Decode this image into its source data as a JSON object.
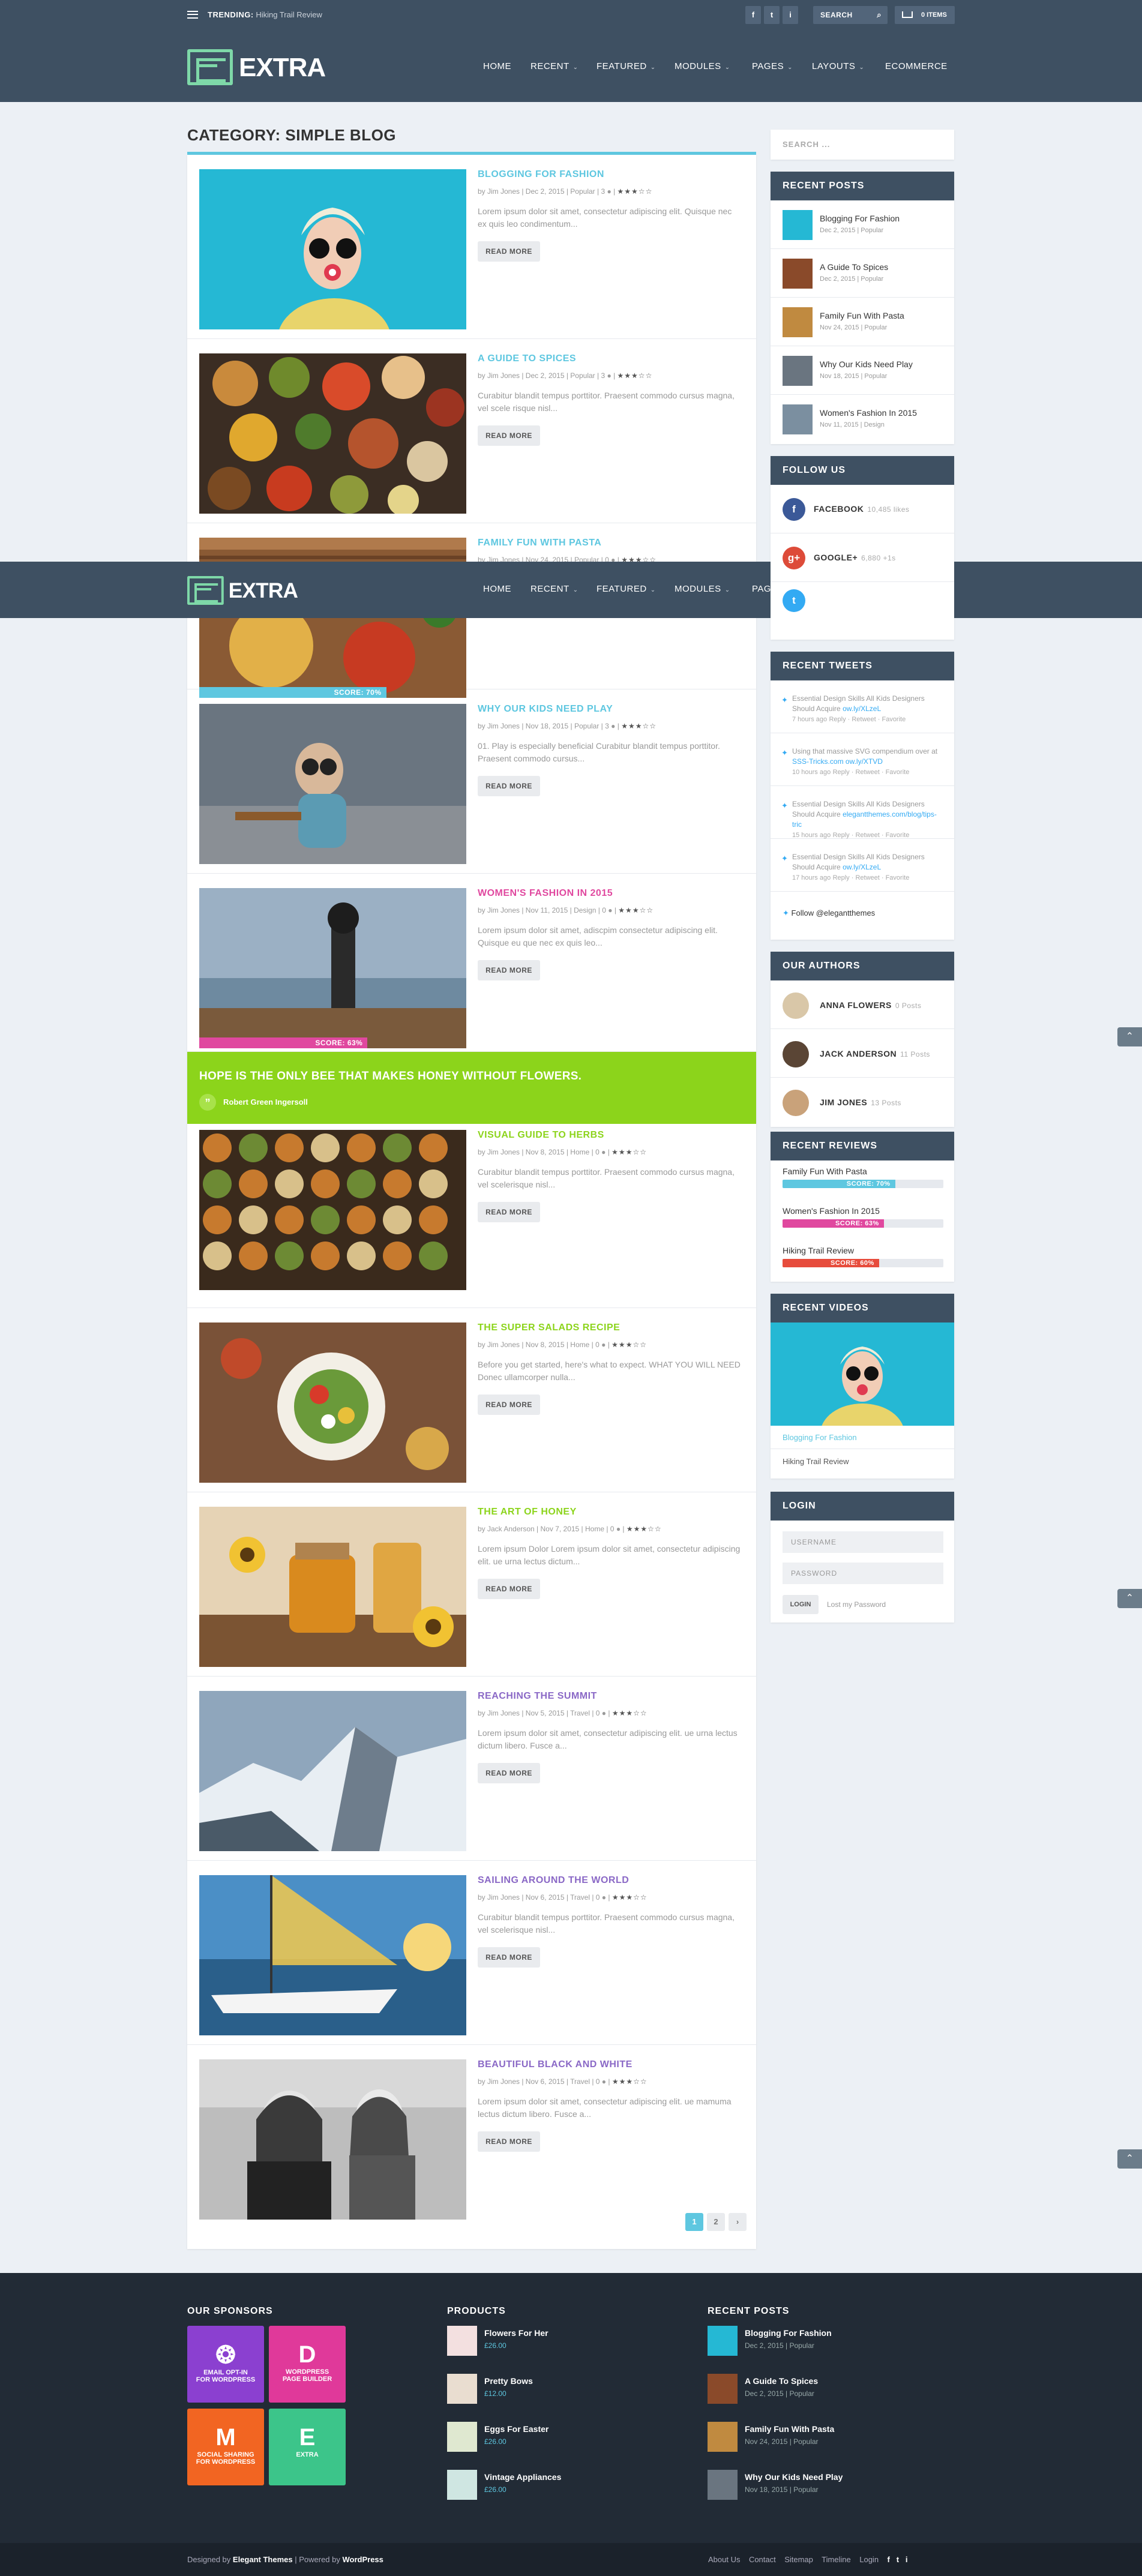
{
  "topbar": {
    "trending_label": "TRENDING:",
    "trending_value": "Hiking Trail Review",
    "social": [
      "f",
      "t",
      "i"
    ],
    "search_label": "SEARCH",
    "cart_label": "0 ITEMS"
  },
  "header": {
    "logo_text": "EXTRA",
    "nav": [
      {
        "label": "HOME"
      },
      {
        "label": "RECENT",
        "caret": "⌄"
      },
      {
        "label": "FEATURED",
        "caret": "⌄"
      },
      {
        "label": "MODULES",
        "caret": "⌄"
      },
      {
        "label": "PAGES",
        "caret": "⌄"
      },
      {
        "label": "LAYOUTS",
        "caret": "⌄"
      },
      {
        "label": "ECOMMERCE"
      }
    ]
  },
  "category_title": "CATEGORY: SIMPLE BLOG",
  "read_more": "READ MORE",
  "posts": [
    {
      "title": "BLOGGING FOR FASHION",
      "color": "#5ec7e0",
      "meta": "by Jim Jones | Dec 2, 2015 | Popular | 3",
      "stars": "★★★☆☆",
      "excerpt": "Lorem ipsum dolor sit amet, consectetur adipiscing elit. Quisque nec ex quis leo condimentum..."
    },
    {
      "title": "A GUIDE TO SPICES",
      "color": "#5ec7e0",
      "meta": "by Jim Jones | Dec 2, 2015 | Popular | 3",
      "stars": "★★★☆☆",
      "excerpt": "Curabitur blandit tempus porttitor. Praesent commodo cursus magna, vel scele risque nisl..."
    },
    {
      "title": "FAMILY FUN WITH PASTA",
      "color": "#5ec7e0",
      "meta": "by Jim Jones | Nov 24, 2015 | Popular | 0",
      "stars": "★★★☆☆",
      "excerpt": "",
      "score": "SCORE: 70%",
      "score_pct": 70
    },
    {
      "title": "WHY OUR KIDS NEED PLAY",
      "color": "#5ec7e0",
      "meta": "by Jim Jones | Nov 18, 2015 | Popular | 3",
      "stars": "★★★☆☆",
      "excerpt": "01. Play is especially beneficial Curabitur blandit tempus porttitor. Praesent commodo cursus..."
    },
    {
      "title": "WOMEN'S FASHION IN 2015",
      "color": "#e0489f",
      "meta": "by Jim Jones | Nov 11, 2015 | Design | 0",
      "stars": "★★★☆☆",
      "excerpt": "Lorem ipsum dolor sit amet, adiscpim consectetur adipiscing elit. Quisque eu que nec ex quis leo...",
      "score": "SCORE: 63%",
      "score_pct": 63
    },
    {
      "title": "VISUAL GUIDE TO HERBS",
      "color": "#8cd41b",
      "meta": "by Jim Jones | Nov 8, 2015 | Home | 0",
      "stars": "★★★☆☆",
      "excerpt": "Curabitur blandit tempus porttitor. Praesent commodo cursus magna, vel scelerisque nisl..."
    },
    {
      "title": "THE SUPER SALADS RECIPE",
      "color": "#8cd41b",
      "meta": "by Jim Jones | Nov 8, 2015 | Home | 0",
      "stars": "★★★☆☆",
      "excerpt": "Before you get started, here's what to expect. WHAT YOU WILL NEED Donec ullamcorper nulla..."
    },
    {
      "title": "THE ART OF HONEY",
      "color": "#8cd41b",
      "meta": "by Jack Anderson | Nov 7, 2015 | Home | 0",
      "stars": "★★★☆☆",
      "excerpt": "Lorem ipsum Dolor Lorem ipsum dolor sit amet, consectetur adipiscing elit. ue urna lectus dictum..."
    },
    {
      "title": "REACHING THE SUMMIT",
      "color": "#8a68c6",
      "meta": "by Jim Jones | Nov 5, 2015 | Travel | 0",
      "stars": "★★★☆☆",
      "excerpt": "Lorem ipsum dolor sit amet, consectetur adipiscing elit. ue urna lectus dictum libero. Fusce a..."
    },
    {
      "title": "SAILING AROUND THE WORLD",
      "color": "#8a68c6",
      "meta": "by Jim Jones | Nov 6, 2015 | Travel | 0",
      "stars": "★★★☆☆",
      "excerpt": "Curabitur blandit tempus porttitor. Praesent commodo cursus magna, vel scelerisque nisl..."
    },
    {
      "title": "BEAUTIFUL BLACK AND WHITE",
      "color": "#8a68c6",
      "meta": "by Jim Jones | Nov 6, 2015 | Travel | 0",
      "stars": "★★★☆☆",
      "excerpt": "Lorem ipsum dolor sit amet, consectetur adipiscing elit. ue mamuma lectus dictum libero. Fusce a..."
    }
  ],
  "quote": {
    "text": "HOPE IS THE ONLY BEE THAT MAKES HONEY WITHOUT FLOWERS.",
    "mark": "”",
    "author": "Robert Green Ingersoll"
  },
  "pagination": [
    "1",
    "2",
    "›"
  ],
  "sidebar": {
    "search_placeholder": "SEARCH ...",
    "recent_posts_title": "RECENT POSTS",
    "recent_posts": [
      {
        "title": "Blogging For Fashion",
        "date": "Dec 2, 2015 | Popular"
      },
      {
        "title": "A Guide To Spices",
        "date": "Dec 2, 2015 | Popular"
      },
      {
        "title": "Family Fun With Pasta",
        "date": "Nov 24, 2015 | Popular"
      },
      {
        "title": "Why Our Kids Need Play",
        "date": "Nov 18, 2015 | Popular"
      },
      {
        "title": "Women's Fashion In 2015",
        "date": "Nov 11, 2015 | Design"
      }
    ],
    "follow_title": "FOLLOW US",
    "follow": [
      {
        "icon": "f",
        "label": "FACEBOOK",
        "count": "10,485 likes",
        "color": "#3b5998"
      },
      {
        "icon": "g+",
        "label": "GOOGLE+",
        "count": "6,880 +1s",
        "color": "#dd4b39"
      }
    ],
    "tweets_title": "RECENT TWEETS",
    "tweets": [
      {
        "text": "Essential Design Skills All Kids Designers Should Acquire",
        "link": "ow.ly/XLzeL",
        "meta": "7 hours ago",
        "actions": "Reply · Retweet · Favorite"
      },
      {
        "text": "Using that massive SVG compendium over at",
        "link": "SSS-Tricks.com ow.ly/XTVD",
        "meta": "10 hours ago",
        "actions": "Reply · Retweet · Favorite"
      },
      {
        "text": "Essential Design Skills All Kids Designers Should Acquire",
        "link": "elegantthemes.com/blog/tips-tric",
        "meta": "15 hours ago",
        "actions": "Reply · Retweet · Favorite"
      },
      {
        "text": "Essential Design Skills All Kids Designers Should Acquire",
        "link": "ow.ly/XLzeL",
        "meta": "17 hours ago",
        "actions": "Reply · Retweet · Favorite"
      }
    ],
    "follow_twitter": "Follow @elegantthemes",
    "authors_title": "OUR AUTHORS",
    "authors": [
      {
        "name": "ANNA FLOWERS",
        "posts": "0 Posts"
      },
      {
        "name": "JACK ANDERSON",
        "posts": "11 Posts"
      },
      {
        "name": "JIM JONES",
        "posts": "13 Posts"
      }
    ],
    "reviews_title": "RECENT REVIEWS",
    "reviews": [
      {
        "title": "Family Fun With Pasta",
        "score": "SCORE: 70%",
        "pct": 70,
        "color": "#5ec7e0"
      },
      {
        "title": "Women's Fashion In 2015",
        "score": "SCORE: 63%",
        "pct": 63,
        "color": "#e0489f"
      },
      {
        "title": "Hiking Trail Review",
        "score": "SCORE: 60%",
        "pct": 60,
        "color": "#e74c3c"
      }
    ],
    "videos_title": "RECENT VIDEOS",
    "videos": [
      "Blogging For Fashion",
      "Hiking Trail Review"
    ],
    "login_title": "LOGIN",
    "login_username": "USERNAME",
    "login_password": "PASSWORD",
    "login_button": "LOGIN",
    "login_lost": "Lost my Password"
  },
  "footer": {
    "sponsors_title": "OUR SPONSORS",
    "sponsors": [
      {
        "big": "❂",
        "label": "EMAIL OPT-IN",
        "sub": "FOR WORDPRESS",
        "color": "#8b40d0"
      },
      {
        "big": "D",
        "label": "WORDPRESS",
        "sub": "PAGE BUILDER",
        "color": "#e0399a"
      },
      {
        "big": "M",
        "label": "SOCIAL SHARING",
        "sub": "FOR WORDPRESS",
        "color": "#f26522"
      },
      {
        "big": "E",
        "label": "EXTRA",
        "sub": "",
        "color": "#3cc58a"
      }
    ],
    "products_title": "PRODUCTS",
    "products": [
      {
        "title": "Flowers For Her",
        "price": "£26.00"
      },
      {
        "title": "Pretty Bows",
        "price": "£12.00"
      },
      {
        "title": "Eggs For Easter",
        "price": "£26.00"
      },
      {
        "title": "Vintage Appliances",
        "price": "£26.00"
      }
    ],
    "recent_title": "RECENT POSTS",
    "recent": [
      {
        "title": "Blogging For Fashion",
        "date": "Dec 2, 2015 | Popular"
      },
      {
        "title": "A Guide To Spices",
        "date": "Dec 2, 2015 | Popular"
      },
      {
        "title": "Family Fun With Pasta",
        "date": "Nov 24, 2015 | Popular"
      },
      {
        "title": "Why Our Kids Need Play",
        "date": "Nov 18, 2015 | Popular"
      }
    ]
  },
  "bottombar": {
    "designed_by": "Designed by",
    "elegant": "Elegant Themes",
    "powered": "| Powered by",
    "wordpress": "WordPress",
    "links": [
      "About Us",
      "Contact",
      "Sitemap",
      "Timeline",
      "Login"
    ],
    "social": [
      "f",
      "t",
      "i"
    ]
  },
  "scrolltop_glyph": "⌃"
}
